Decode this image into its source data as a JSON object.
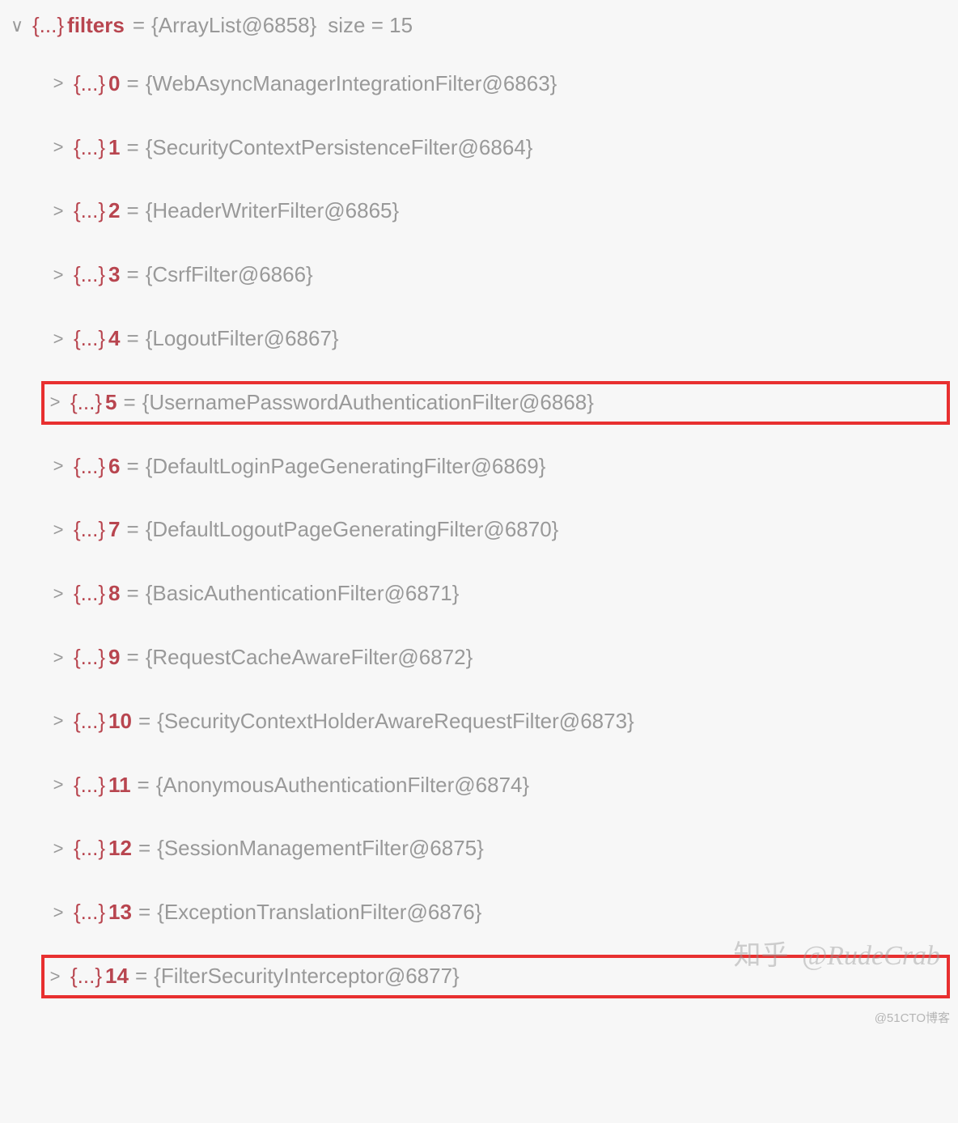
{
  "root": {
    "name": "filters",
    "type": "ArrayList",
    "objectId": "6858",
    "sizeLabel": "size = 15"
  },
  "items": [
    {
      "index": "0",
      "value": "{WebAsyncManagerIntegrationFilter@6863}",
      "highlighted": false
    },
    {
      "index": "1",
      "value": "{SecurityContextPersistenceFilter@6864}",
      "highlighted": false
    },
    {
      "index": "2",
      "value": "{HeaderWriterFilter@6865}",
      "highlighted": false
    },
    {
      "index": "3",
      "value": "{CsrfFilter@6866}",
      "highlighted": false
    },
    {
      "index": "4",
      "value": "{LogoutFilter@6867}",
      "highlighted": false
    },
    {
      "index": "5",
      "value": "{UsernamePasswordAuthenticationFilter@6868}",
      "highlighted": true
    },
    {
      "index": "6",
      "value": "{DefaultLoginPageGeneratingFilter@6869}",
      "highlighted": false
    },
    {
      "index": "7",
      "value": "{DefaultLogoutPageGeneratingFilter@6870}",
      "highlighted": false
    },
    {
      "index": "8",
      "value": "{BasicAuthenticationFilter@6871}",
      "highlighted": false
    },
    {
      "index": "9",
      "value": "{RequestCacheAwareFilter@6872}",
      "highlighted": false
    },
    {
      "index": "10",
      "value": "{SecurityContextHolderAwareRequestFilter@6873}",
      "highlighted": false
    },
    {
      "index": "11",
      "value": "{AnonymousAuthenticationFilter@6874}",
      "highlighted": false
    },
    {
      "index": "12",
      "value": "{SessionManagementFilter@6875}",
      "highlighted": false
    },
    {
      "index": "13",
      "value": "{ExceptionTranslationFilter@6876}",
      "highlighted": false
    },
    {
      "index": "14",
      "value": "{FilterSecurityInterceptor@6877}",
      "highlighted": true
    }
  ],
  "braceGlyph": "{...}",
  "equals": " = ",
  "watermark": {
    "brand": "知乎",
    "handle": "@RudeCrab"
  },
  "cornerWatermark": "@51CTO博客"
}
